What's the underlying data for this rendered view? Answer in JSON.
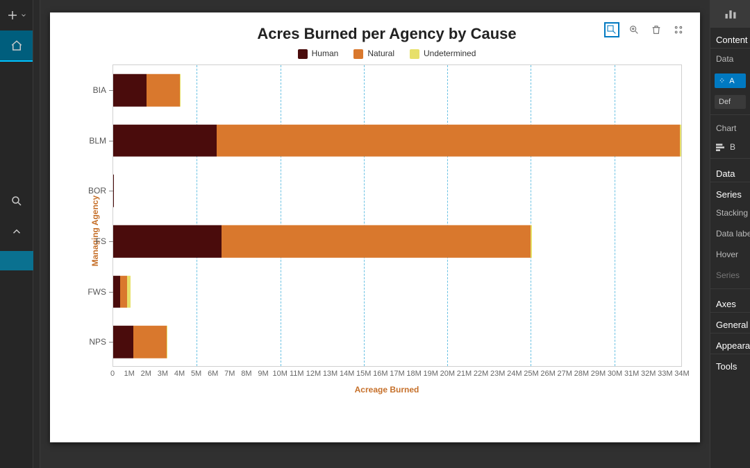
{
  "colors": {
    "human": "#4a0c0c",
    "natural": "#d9782d",
    "undetermined": "#e7e06a",
    "accent": "#0079c1"
  },
  "chart_data": {
    "type": "bar",
    "orientation": "horizontal",
    "stacked": true,
    "title": "Acres Burned per Agency by Cause",
    "xlabel": "Acreage Burned",
    "ylabel": "Managing Agency",
    "xlim": [
      0,
      34000000
    ],
    "xgrid_interval": 5000000,
    "categories": [
      "BIA",
      "BLM",
      "BOR",
      "FS",
      "FWS",
      "NPS"
    ],
    "series": [
      {
        "name": "Human",
        "color": "#4a0c0c",
        "values": [
          2000000,
          6200000,
          5000,
          6500000,
          400000,
          1200000
        ]
      },
      {
        "name": "Natural",
        "color": "#d9782d",
        "values": [
          2000000,
          27800000,
          3000,
          18500000,
          450000,
          2000000
        ]
      },
      {
        "name": "Undetermined",
        "color": "#e7e06a",
        "values": [
          20000,
          100000,
          0,
          50000,
          200000,
          40000
        ]
      }
    ],
    "xticks": [
      0,
      1000000,
      2000000,
      3000000,
      4000000,
      5000000,
      6000000,
      7000000,
      8000000,
      9000000,
      10000000,
      11000000,
      12000000,
      13000000,
      14000000,
      15000000,
      16000000,
      17000000,
      18000000,
      19000000,
      20000000,
      21000000,
      22000000,
      23000000,
      24000000,
      25000000,
      26000000,
      27000000,
      28000000,
      29000000,
      30000000,
      31000000,
      32000000,
      33000000,
      34000000
    ],
    "xtick_labels": [
      "0",
      "1M",
      "2M",
      "3M",
      "4M",
      "5M",
      "6M",
      "7M",
      "8M",
      "9M",
      "10M",
      "11M",
      "12M",
      "13M",
      "14M",
      "15M",
      "16M",
      "17M",
      "18M",
      "19M",
      "20M",
      "21M",
      "22M",
      "23M",
      "24M",
      "25M",
      "26M",
      "27M",
      "28M",
      "29M",
      "30M",
      "31M",
      "32M",
      "33M",
      "34M"
    ]
  },
  "right_panel": {
    "header_tab": "Chart",
    "content_label": "Content",
    "data_header": "Data",
    "chip_text": "A",
    "definition_label": "Def",
    "chart_header": "Chart",
    "chart_type_label": "B",
    "data_section": "Data",
    "series_section": "Series",
    "stacking_label": "Stacking",
    "data_labels_label": "Data labels",
    "hover_label": "Hover",
    "series_line": "Series",
    "axes_section": "Axes",
    "general_section": "General",
    "appearance_section": "Appearance",
    "tools_section": "Tools"
  },
  "left_toolbar": {
    "add_label": "Add",
    "home_label": "Home",
    "search_label": "Search",
    "collapse_label": "Collapse"
  },
  "chart_toolbar": {
    "select_label": "Selection",
    "zoom_label": "Zoom",
    "clear_label": "Clear selection",
    "grid_label": "Switch view"
  }
}
